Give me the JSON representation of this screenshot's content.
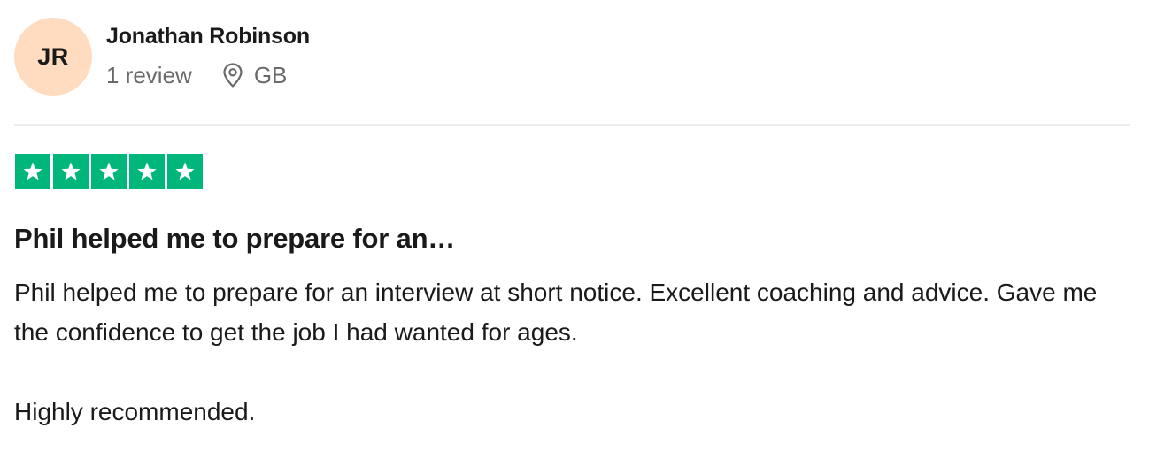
{
  "consumer": {
    "initials": "JR",
    "avatar_color": "#ffdbbf",
    "name": "Jonathan Robinson",
    "review_count": "1 review",
    "location_icon": "location-pin-icon",
    "country": "GB"
  },
  "rating": {
    "stars": 5,
    "max": 5,
    "color": "#00b67a"
  },
  "review": {
    "title": "Phil helped me to prepare for an…",
    "paragraphs": [
      "Phil helped me to prepare for an interview at short notice. Excellent coaching and advice. Gave me the confidence to get the job I had wanted for ages.",
      "Highly recommended."
    ]
  }
}
